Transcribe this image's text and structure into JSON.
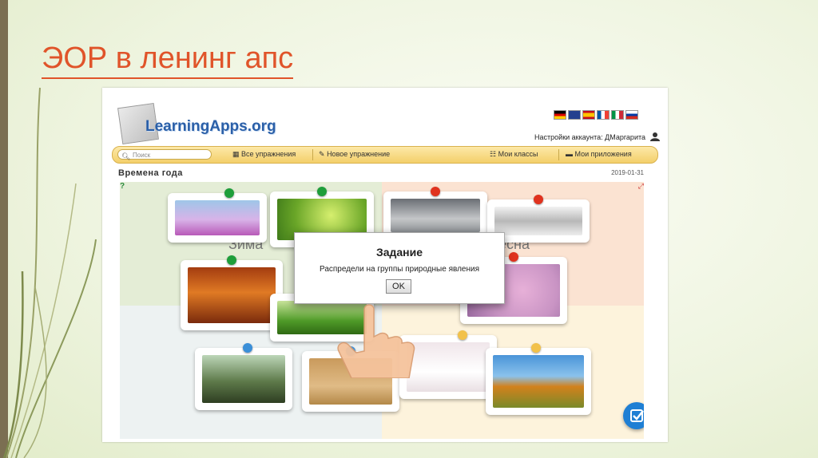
{
  "slide": {
    "title": "ЭОР в ленинг апс"
  },
  "app": {
    "logo_text": "LearningApps.org",
    "account_text": "Настройки аккаунта: ДМаргарита",
    "search_placeholder": "Поиск",
    "nav": {
      "all_exercises": "Все упражнения",
      "new_exercise": "Новое упражнение",
      "my_classes": "Мои классы",
      "my_apps": "Мои приложения"
    },
    "exercise_title": "Времена года",
    "date": "2019-01-31"
  },
  "board": {
    "zones": [
      "Зима",
      "Весна"
    ],
    "pin_colors": {
      "green": "#1e9e3a",
      "red": "#e0321e",
      "blue": "#3a8fd8",
      "yellow": "#f2c14a"
    }
  },
  "dialog": {
    "title": "Задание",
    "text": "Распредели на группы природные явления",
    "ok_label": "OK"
  },
  "icons": [
    "search-icon",
    "grid-icon",
    "pencil-icon",
    "list-icon",
    "folder-icon",
    "user-icon",
    "help-icon",
    "fullscreen-icon",
    "check-icon",
    "hand-pointer-icon"
  ]
}
